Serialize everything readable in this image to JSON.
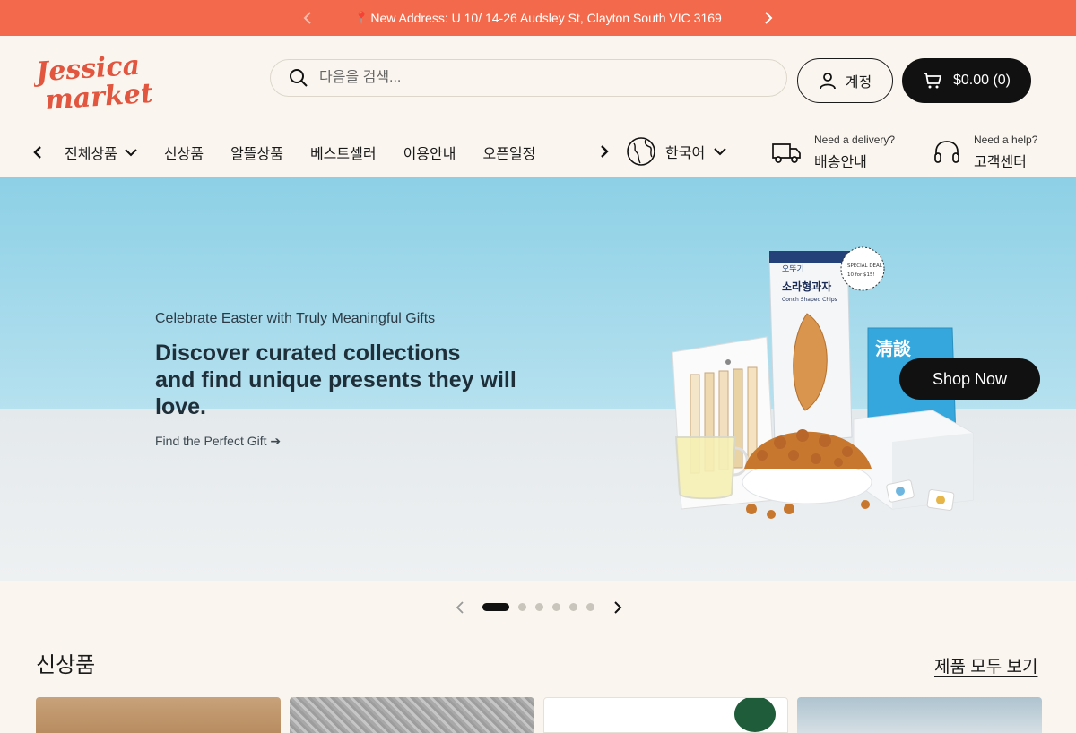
{
  "announcement": {
    "pin_icon": "map-pin-icon",
    "text": "New Address: U 10/ 14-26 Audsley St, Clayton South VIC 3169"
  },
  "header": {
    "logo_line1": "Jessica",
    "logo_line2": "market",
    "search_placeholder": "다음을 검색...",
    "account_label": "계정",
    "cart_label": "$0.00 (0)"
  },
  "nav": {
    "items": [
      {
        "label": "전체상품",
        "has_dropdown": true
      },
      {
        "label": "신상품"
      },
      {
        "label": "알뜰상품"
      },
      {
        "label": "베스트셀러"
      },
      {
        "label": "이용안내"
      },
      {
        "label": "오픈일정"
      }
    ],
    "language": "한국어",
    "delivery": {
      "small": "Need a delivery?",
      "big": "배송안내"
    },
    "support": {
      "small": "Need a help?",
      "big": "고객센터"
    }
  },
  "hero": {
    "eyebrow": "Celebrate Easter with Truly Meaningful Gifts",
    "headline_line1": "Discover curated collections",
    "headline_line2": "and find unique presents they will love.",
    "link": "Find the Perfect Gift ➔",
    "cta": "Shop Now",
    "pkg1_line1": "소라형과자",
    "pkg1_line2": "Conch Shaped Chips",
    "pkg1_brand": "오뚜기",
    "pkg1_deal_line1": "SPECIAL DEAL",
    "pkg1_deal_line2": "10 for $15!",
    "pkg2_text": "淸談"
  },
  "slider": {
    "slide_count": 6,
    "active_index": 0
  },
  "section": {
    "title": "신상품",
    "view_all": "제품 모두 보기"
  },
  "colors": {
    "announcement_bg": "#f26a4b",
    "page_bg": "#faf6ef",
    "logo": "#e2553f",
    "button_dark": "#111111"
  }
}
